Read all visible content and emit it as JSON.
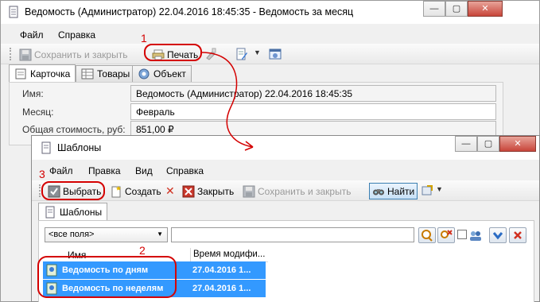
{
  "main_window": {
    "title": "Ведомость (Администратор) 22.04.2016 18:45:35 - Ведомость за месяц",
    "menu": [
      "Файл",
      "Справка"
    ],
    "toolbar": {
      "save_close": "Сохранить и закрыть",
      "print": "Печать"
    },
    "tabs": [
      "Карточка",
      "Товары",
      "Объект"
    ],
    "fields": {
      "name_label": "Имя:",
      "name_value": "Ведомость (Администратор) 22.04.2016 18:45:35",
      "month_label": "Месяц:",
      "month_value": "Февраль",
      "total_label": "Общая стоимость, руб:",
      "total_value": "851,00 ₽"
    }
  },
  "templates_window": {
    "title": "Шаблоны",
    "menu": [
      "Файл",
      "Правка",
      "Вид",
      "Справка"
    ],
    "toolbar": {
      "select": "Выбрать",
      "create": "Создать",
      "close": "Закрыть",
      "save_close": "Сохранить и закрыть",
      "find": "Найти"
    },
    "tab": "Шаблоны",
    "filter": {
      "field_select": "<все поля>",
      "search_value": ""
    },
    "table": {
      "columns": [
        "Имя",
        "Время модифи..."
      ],
      "rows": [
        {
          "name": "Ведомость по дням",
          "time": "27.04.2016 1..."
        },
        {
          "name": "Ведомость по неделям",
          "time": "27.04.2016 1..."
        }
      ]
    }
  },
  "annotations": [
    "1",
    "2",
    "3"
  ],
  "colors": {
    "annotation": "#d40000",
    "selection": "#3399ff"
  }
}
